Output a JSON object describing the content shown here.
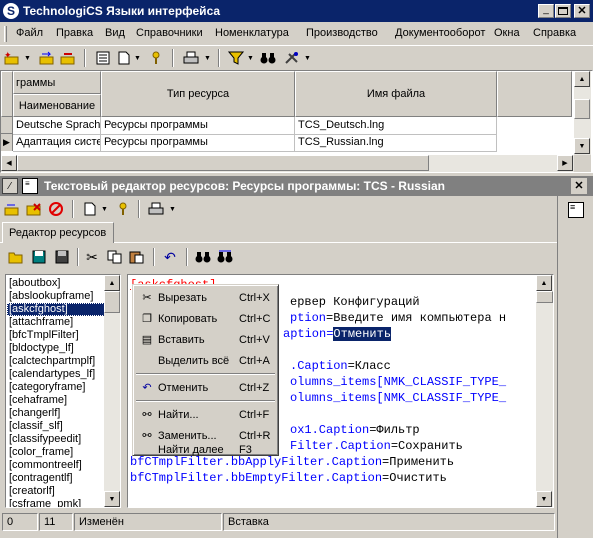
{
  "window": {
    "title": "TechnologiCS Языки интерфейса",
    "icon": "app-logo-icon"
  },
  "menubar": [
    "Файл",
    "Правка",
    "Вид",
    "Справочники",
    "Номенклатура",
    "Производство",
    "Документооборот",
    "Окна",
    "Справка"
  ],
  "grid": {
    "group_header": "граммы",
    "columns": [
      "Наименование",
      "Тип ресурса",
      "Имя файла"
    ],
    "rows": [
      [
        "Deutsche Sprach",
        "Ресурсы программы",
        "TCS_Deutsch.lng"
      ],
      [
        "Адаптация систе",
        "Ресурсы программы",
        "TCS_Russian.lng"
      ]
    ]
  },
  "editor": {
    "title": "Текстовый редактор ресурсов: Ресурсы программы: TCS - Russian",
    "tab": "Редактор ресурсов",
    "sections": [
      "[aboutbox]",
      "[abslookupframe]",
      "[askcfghost]",
      "[attachframe]",
      "[bfcTmplFilter]",
      "[bldoctype_lf]",
      "[calctechpartmplf]",
      "[calendartypes_lf]",
      "[categoryframe]",
      "[cehaframe]",
      "[changerlf]",
      "[classif_slf]",
      "[classifypeedit]",
      "[color_frame]",
      "[commontreelf]",
      "[contragentlf]",
      "[creatorlf]",
      "[csframe_pmk]"
    ],
    "selected_section": "[askcfghost]",
    "code": {
      "line1": "[askcfghost]",
      "line2": "ервер Конфигураций",
      "line3a": "ption",
      "line3b": "=Введите имя компьютера н",
      "line4a": "aption",
      "line4b": "=",
      "line4c": "Отменить",
      "line5a": ".Caption",
      "line5b": "=Класс",
      "line6": "olumns_items[NMK_CLASSIF_TYPE_",
      "line7": "olumns_items[NMK_CLASSIF_TYPE_",
      "line8a": "ox1.Caption",
      "line8b": "=Фильтр",
      "line9a": "Filter.Caption",
      "line9b": "=Сохранить",
      "line10a": "bfCTmplFilter.bbApplyFilter.Caption",
      "line10b": "=Применить",
      "line11a": "bfCTmplFilter.bbEmptyFilter.Caption",
      "line11b": "=Очистить"
    }
  },
  "context_menu": [
    {
      "icon": "scissors-icon",
      "label": "Вырезать",
      "shortcut": "Ctrl+X"
    },
    {
      "icon": "copy-icon",
      "label": "Копировать",
      "shortcut": "Ctrl+C"
    },
    {
      "icon": "paste-icon",
      "label": "Вставить",
      "shortcut": "Ctrl+V"
    },
    {
      "icon": "",
      "label": "Выделить всё",
      "shortcut": "Ctrl+A"
    },
    {
      "icon": "undo-icon",
      "label": "Отменить",
      "shortcut": "Ctrl+Z"
    },
    {
      "icon": "binoculars-icon",
      "label": "Найти...",
      "shortcut": "Ctrl+F"
    },
    {
      "icon": "replace-icon",
      "label": "Заменить...",
      "shortcut": "Ctrl+R"
    },
    {
      "icon": "",
      "label": "Найти далее",
      "shortcut": "F3"
    }
  ],
  "statusbar": {
    "line": "0",
    "col": "11",
    "modified": "Изменён",
    "mode": "Вставка"
  },
  "colors": {
    "titlebar": "#0a246a",
    "selection": "#0a246a",
    "keyword_blue": "#0000ff",
    "section_red": "#ff0000"
  }
}
